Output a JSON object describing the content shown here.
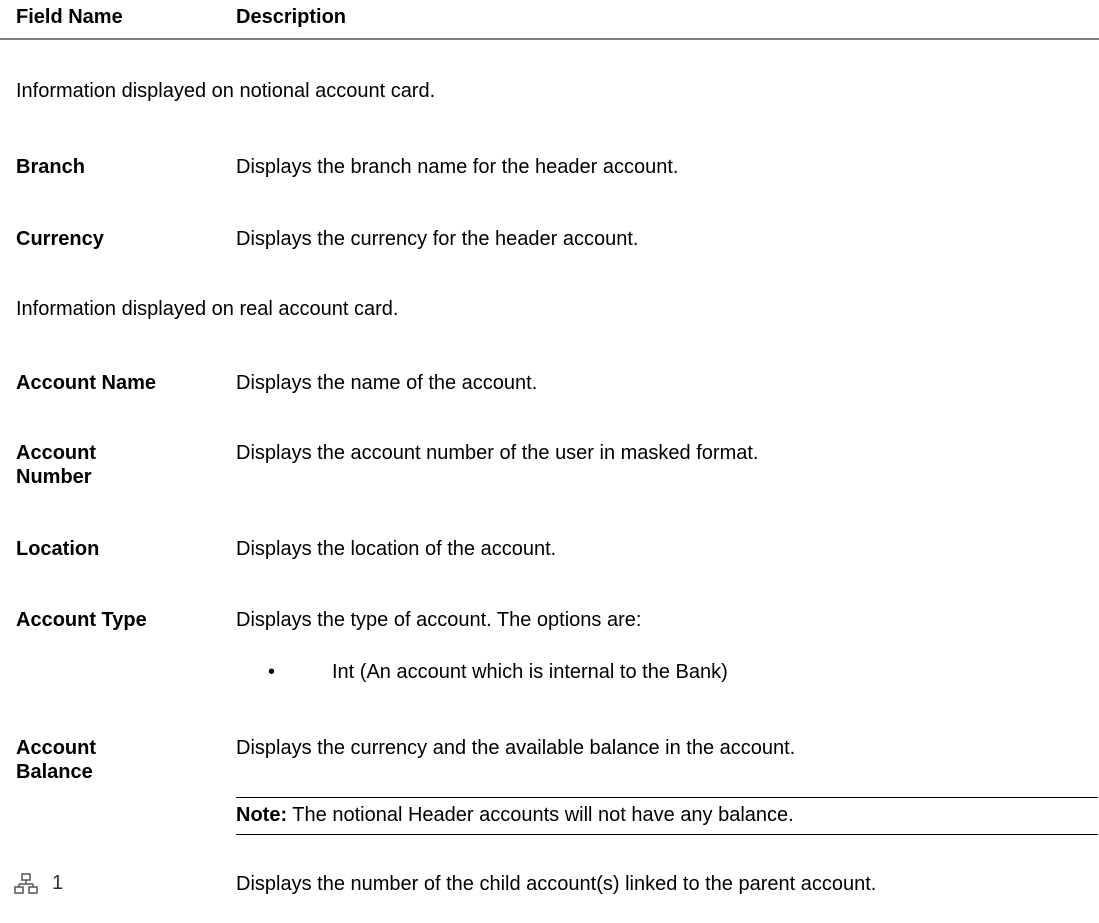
{
  "table": {
    "header": {
      "field_name": "Field Name",
      "description": "Description"
    },
    "notional_intro": "Information displayed on notional account card.",
    "notional_rows": [
      {
        "field": "Branch",
        "description": "Displays the branch name for the header account."
      },
      {
        "field": "Currency",
        "description": "Displays the currency for the header account."
      }
    ],
    "real_intro": "Information displayed on real account card.",
    "real_rows": [
      {
        "field": "Account Name",
        "description": "Displays the name of the account."
      },
      {
        "field_line1": "Account",
        "field_line2": "Number",
        "description": "Displays the account number of the user in masked format."
      },
      {
        "field": "Location",
        "description": "Displays the location of the account."
      },
      {
        "field": "Account Type",
        "description": "Displays the type of account. The options are:",
        "bullets": [
          "Int (An account which is internal to the Bank)"
        ]
      },
      {
        "field_line1": "Account",
        "field_line2": "Balance",
        "description": "Displays the currency and the available balance in the account.",
        "note_label": "Note:",
        "note_text": " The notional Header accounts will not have any balance."
      }
    ],
    "hierarchy_row": {
      "icon": "hierarchy-icon",
      "count": "1",
      "description": "Displays the number of the child account(s) linked to the parent account."
    }
  },
  "colors": {
    "header_rule": "#808080",
    "text": "#000000",
    "icon": "#555555"
  }
}
